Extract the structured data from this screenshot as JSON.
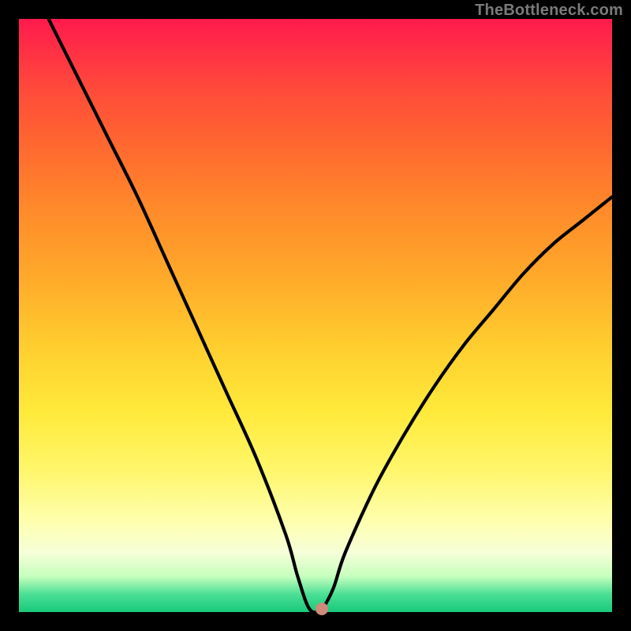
{
  "watermark": "TheBottleneck.com",
  "chart_data": {
    "type": "line",
    "title": "",
    "xlabel": "",
    "ylabel": "",
    "xlim": [
      0,
      100
    ],
    "ylim": [
      0,
      100
    ],
    "grid": false,
    "legend": false,
    "series": [
      {
        "name": "bottleneck-curve",
        "x": [
          5,
          10,
          15,
          20,
          25,
          30,
          35,
          40,
          45,
          47,
          49,
          51,
          53,
          55,
          60,
          65,
          70,
          75,
          80,
          85,
          90,
          95,
          100
        ],
        "y": [
          100,
          90,
          80,
          70,
          59,
          48,
          37,
          26,
          13,
          6,
          0.5,
          0.5,
          4,
          10,
          21,
          30,
          38,
          45,
          51,
          57,
          62,
          66,
          70
        ]
      }
    ],
    "marker": {
      "x": 51,
      "y": 0.5,
      "color": "#cf8a7b"
    },
    "gradient_colors": {
      "top": "#ff1a4d",
      "middle": "#ffe93a",
      "bottom": "#18c97a"
    }
  }
}
